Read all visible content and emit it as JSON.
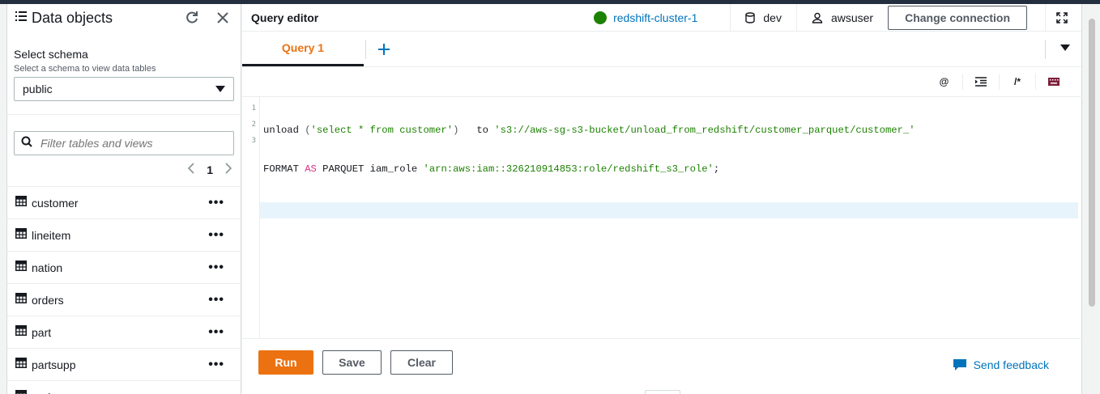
{
  "left_panel": {
    "title": "Data objects",
    "schema_label": "Select schema",
    "schema_hint": "Select a schema to view data tables",
    "schema_value": "public",
    "filter_placeholder": "Filter tables and views",
    "page": "1",
    "tables": [
      {
        "name": "customer"
      },
      {
        "name": "lineitem"
      },
      {
        "name": "nation"
      },
      {
        "name": "orders"
      },
      {
        "name": "part"
      },
      {
        "name": "partsupp"
      },
      {
        "name": "region"
      }
    ]
  },
  "header": {
    "title": "Query editor",
    "cluster": "redshift-cluster-1",
    "cluster_status_color": "#1d8102",
    "database": "dev",
    "user": "awsuser",
    "change_connection": "Change connection"
  },
  "tabs": [
    {
      "label": "Query 1"
    }
  ],
  "toolbar": {
    "at": "@",
    "comment": "/*"
  },
  "editor": {
    "line_numbers": [
      "1",
      "2",
      "3"
    ],
    "line1": {
      "kw": "unload ",
      "open": "(",
      "s1": "'select * from customer'",
      "close": ")",
      "to": "   to ",
      "s2": "'s3://aws-sg-s3-bucket/unload_from_redshift/customer_parquet/customer_'"
    },
    "line2": {
      "format": "FORMAT ",
      "as": "AS",
      "rest": " PARQUET iam_role ",
      "s": "'arn:aws:iam::326210914853:role/redshift_s3_role'",
      "semi": ";"
    }
  },
  "actions": {
    "run": "Run",
    "save": "Save",
    "clear": "Clear",
    "feedback": "Send feedback"
  },
  "colors": {
    "accent": "#ec7211",
    "link": "#0073bb"
  }
}
